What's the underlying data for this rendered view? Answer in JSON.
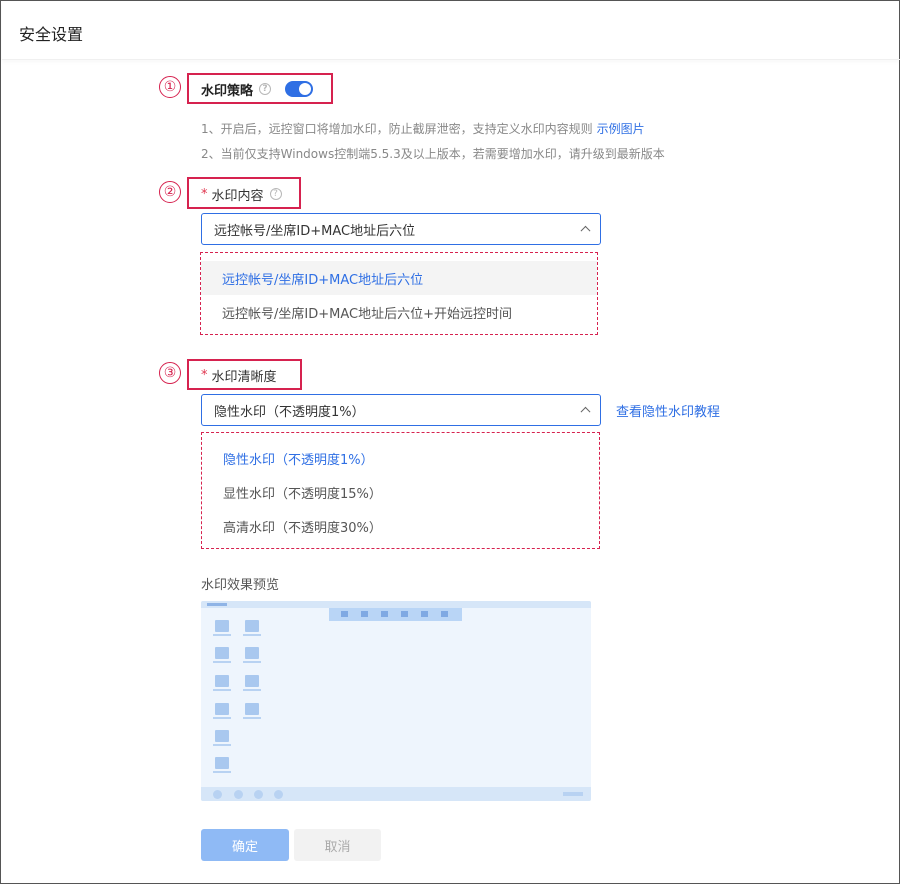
{
  "header": {
    "title": "安全设置"
  },
  "section1": {
    "number": "①",
    "label": "水印策略",
    "help": "?",
    "toggle_on": true,
    "notes": [
      {
        "text": "1、开启后，远控窗口将增加水印，防止截屏泄密，支持定义水印内容规则",
        "link": "示例图片"
      },
      {
        "text": "2、当前仅支持Windows控制端5.5.3及以上版本，若需要增加水印，请升级到最新版本",
        "link": ""
      }
    ]
  },
  "section2": {
    "number": "②",
    "required": "*",
    "label": "水印内容",
    "help": "?",
    "selected_value": "远控帐号/坐席ID+MAC地址后六位",
    "options": [
      "远控帐号/坐席ID+MAC地址后六位",
      "远控帐号/坐席ID+MAC地址后六位+开始远控时间"
    ]
  },
  "section3": {
    "number": "③",
    "required": "*",
    "label": "水印清晰度",
    "selected_value": "隐性水印（不透明度1%）",
    "side_link": "查看隐性水印教程",
    "options": [
      "隐性水印（不透明度1%）",
      "显性水印（不透明度15%）",
      "高清水印（不透明度30%）"
    ]
  },
  "preview": {
    "label": "水印效果预览"
  },
  "buttons": {
    "confirm": "确定",
    "cancel": "取消"
  },
  "colors": {
    "accent": "#2f6fe4",
    "highlight": "#d6224f"
  }
}
